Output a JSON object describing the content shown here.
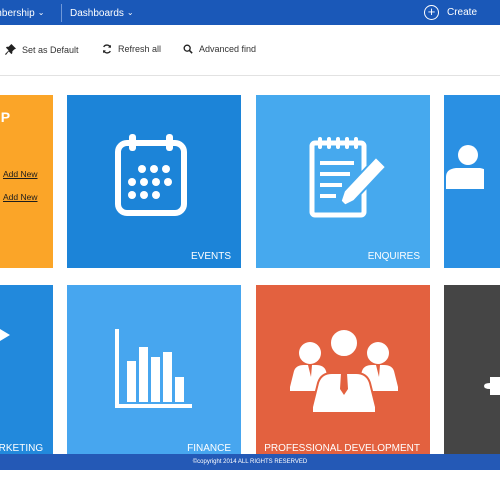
{
  "topbar": {
    "membership_label": "embership",
    "dashboards_label": "Dashboards",
    "create_label": "Create",
    "color": "#1a58b8"
  },
  "toolbar": {
    "set_default_label": "Set as Default",
    "refresh_label": "Refresh all",
    "advanced_find_label": "Advanced find"
  },
  "tiles": {
    "membership": {
      "title": "IIP",
      "link_1": "Add New",
      "link_2": "Add New",
      "color": "#fba528"
    },
    "events": {
      "label": "EVENTS",
      "icon": "calendar-icon",
      "color": "#1c84d8"
    },
    "enquires": {
      "label": "ENQUIRES",
      "icon": "notepad-pencil-icon",
      "color": "#46a9ee"
    },
    "contacts": {
      "icon": "person-icon",
      "color": "#2a90e3"
    },
    "marketing": {
      "label": "ARKETING",
      "icon": "megaphone-icon",
      "color": "#2289dc"
    },
    "finance": {
      "label": "FINANCE",
      "icon": "bar-chart-icon",
      "color": "#47a6ef"
    },
    "professional_development": {
      "label": "PROFESSIONAL DEVELOPMENT",
      "icon": "people-group-icon",
      "color": "#e3613f"
    },
    "settings": {
      "icon": "puzzle-icon",
      "color": "#454545"
    }
  },
  "footer": {
    "copyright": "©copyright 2014 ALL RIGHTS RESERVED"
  }
}
